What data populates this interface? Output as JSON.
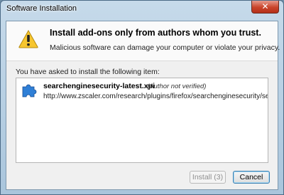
{
  "window": {
    "title": "Software Installation",
    "close_glyph": "✕"
  },
  "header": {
    "icon": "warning-icon",
    "headline": "Install add-ons only from authors whom you trust.",
    "subline": "Malicious software can damage your computer or violate your privacy."
  },
  "main": {
    "ask_text": "You have asked to install the following item:",
    "items": [
      {
        "icon": "addon-puzzle-icon",
        "name": "searchenginesecurity-latest.xpi",
        "status": "(Author not verified)",
        "url": "http://www.zscaler.com/research/plugins/firefox/searchenginesecurity/searchengine"
      }
    ]
  },
  "buttons": {
    "install_label": "Install (3)",
    "cancel_label": "Cancel"
  },
  "colors": {
    "warning_yellow": "#f7c62f",
    "puzzle_blue": "#2f7fd6",
    "close_red": "#c9442a"
  }
}
